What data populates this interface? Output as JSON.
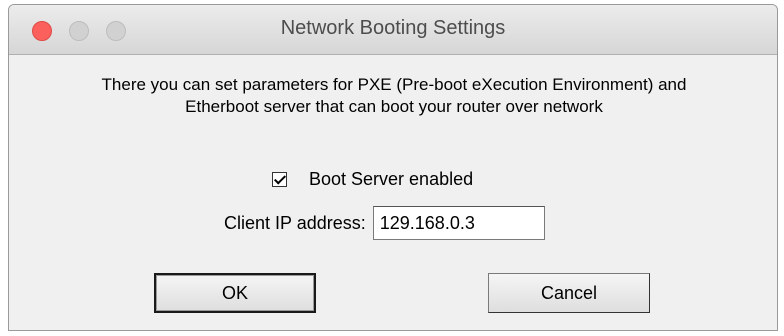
{
  "window": {
    "title": "Network Booting Settings"
  },
  "dialog": {
    "description": "There you can set parameters for PXE (Pre-boot eXecution Environment) and Etherboot server that can boot your router over network",
    "boot_server_label": "Boot Server enabled",
    "boot_server_checked": true,
    "client_ip_label": "Client IP address:",
    "client_ip_value": "129.168.0.3"
  },
  "buttons": {
    "ok_label": "OK",
    "cancel_label": "Cancel"
  },
  "colors": {
    "close_button": "#fc605c",
    "inactive_button": "#d1d1d1",
    "dialog_background": "#f0f0f0"
  }
}
